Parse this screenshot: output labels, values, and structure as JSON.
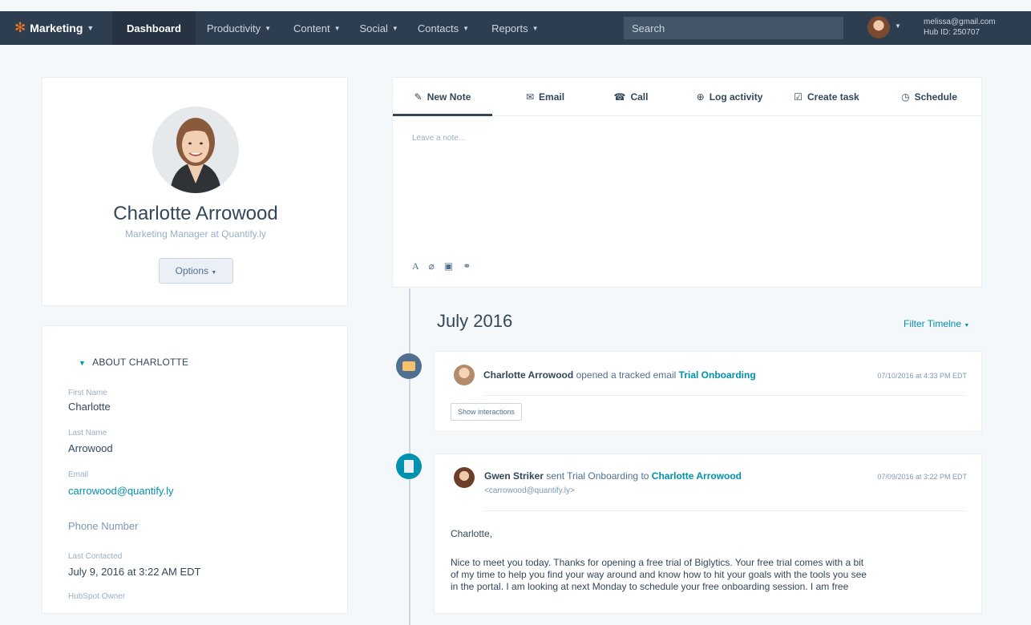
{
  "topbar": {
    "brand": "Marketing",
    "nav": [
      {
        "label": "Dashboard",
        "active": true,
        "caret": false
      },
      {
        "label": "Productivity",
        "caret": true
      },
      {
        "label": "Content",
        "caret": true
      },
      {
        "label": "Social",
        "caret": true
      },
      {
        "label": "Contacts",
        "caret": true
      },
      {
        "label": "Reports",
        "caret": true
      }
    ],
    "search_placeholder": "Search",
    "user_email": "melissa@gmail.com",
    "hub_id": "Hub ID: 250707"
  },
  "profile": {
    "name": "Charlotte Arrowood",
    "title": "Marketing Manager at Quantify.ly",
    "options_label": "Options"
  },
  "about": {
    "header": "ABOUT CHARLOTTE",
    "fields": [
      {
        "label": "First Name",
        "value": "Charlotte"
      },
      {
        "label": "Last Name",
        "value": "Arrowood"
      },
      {
        "label": "Email",
        "value": "carrowood@quantify.ly"
      },
      {
        "label": "",
        "value": "Phone Number"
      },
      {
        "label": "Last Contacted",
        "value": "July 9, 2016 at 3:22 AM EDT"
      },
      {
        "label": "HubSpot Owner",
        "value": ""
      }
    ]
  },
  "composer": {
    "tabs": [
      "New Note",
      "Email",
      "Call",
      "Log activity",
      "Create task",
      "Schedule"
    ],
    "note_placeholder": "Leave a note..."
  },
  "timeline": {
    "month": "July 2016",
    "filter_label": "Filter Timelne",
    "events": [
      {
        "actor": "Charlotte Arrowood",
        "action": "opened a tracked email",
        "link": "Trial Onboarding",
        "date": "07/10/2016 at 4:33 PM EDT",
        "button": "Show interactions"
      },
      {
        "actor": "Gwen Striker",
        "action": "sent Trial Onboarding to",
        "link": "Charlotte Arrowood",
        "sub": "<carrowood@quantify.ly>",
        "date": "07/09/2016 at 3:22 PM EDT",
        "greeting": "Charlotte,",
        "body_lines": [
          "Nice to meet you today.  Thanks for opening a free trial of Biglytics.  Your free trial comes with a bit",
          "of my time to help you find your way around and know how to hit your goals with the tools you see",
          "in the portal.  I am looking at next Monday to schedule your free onboarding session.  I am free"
        ]
      }
    ]
  },
  "colors": {
    "nav_bg": "#2d3e50",
    "accent_link": "#0091ae",
    "brand_orange": "#f57722"
  }
}
